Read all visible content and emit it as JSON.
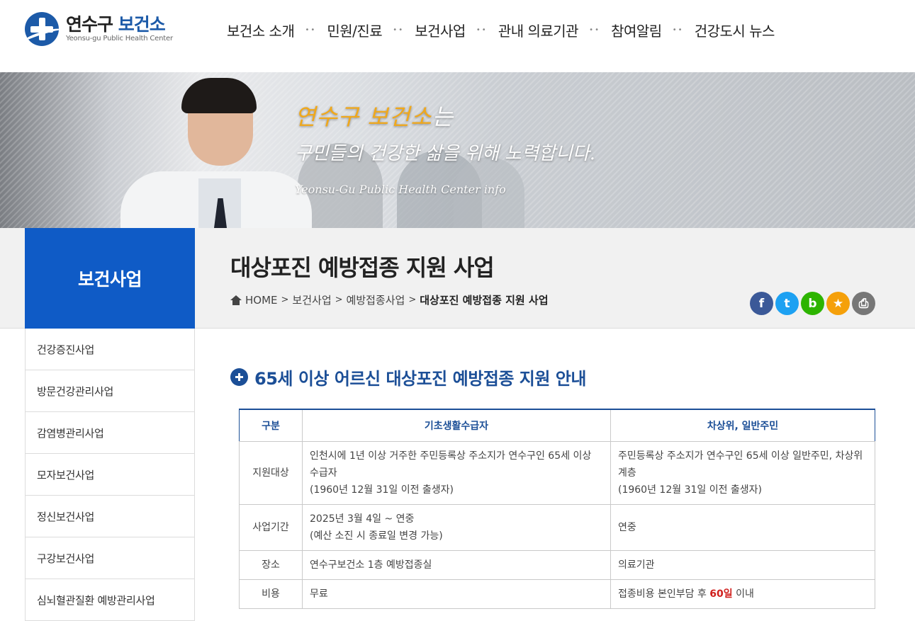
{
  "header": {
    "logo_title_a": "연수구",
    "logo_title_b": "보건소",
    "logo_sub": "Yeonsu-gu Public Health Center",
    "nav": [
      "보건소 소개",
      "민원/진료",
      "보건사업",
      "관내 의료기관",
      "참여알림",
      "건강도시 뉴스"
    ],
    "nav_sep": "••"
  },
  "banner": {
    "line1_gold": "연수구 보건소",
    "line1_rest": "는",
    "line2": "구민들의 건강한 삶을 위해 노력합니다.",
    "line3": "Yeonsu-Gu Public Health Center info"
  },
  "side": {
    "title": "보건사업",
    "menu": [
      "건강증진사업",
      "방문건강관리사업",
      "감염병관리사업",
      "모자보건사업",
      "정신보건사업",
      "구강보건사업",
      "심뇌혈관질환 예방관리사업"
    ]
  },
  "page": {
    "title": "대상포진 예방접종 지원 사업",
    "breadcrumb": [
      "HOME",
      "보건사업",
      "예방접종사업",
      "대상포진 예방접종 지원 사업"
    ],
    "bc_sep": ">",
    "share": [
      {
        "icon": "facebook-icon",
        "glyph": "f",
        "color": "#3b5998"
      },
      {
        "icon": "twitter-icon",
        "glyph": "t",
        "color": "#1da1f2"
      },
      {
        "icon": "blog-icon",
        "glyph": "b",
        "color": "#2db400"
      },
      {
        "icon": "bookmark-star-icon",
        "glyph": "★",
        "color": "#f5a00a"
      },
      {
        "icon": "print-icon",
        "glyph": "⎙",
        "color": "#777777"
      }
    ]
  },
  "content": {
    "section_title": "65세 이상 어르신 대상포진 예방접종 지원 안내",
    "table": {
      "headers": [
        "구분",
        "기초생활수급자",
        "차상위, 일반주민"
      ],
      "rows": [
        {
          "label": "지원대상",
          "a1": "인천시에 1년 이상 거주한 주민등록상 주소지가 연수구인 65세 이상 수급자",
          "a2": "(1960년 12월 31일 이전 출생자)",
          "b1": "주민등록상 주소지가 연수구인 65세 이상 일반주민, 차상위 계층",
          "b2": "(1960년 12월 31일 이전 출생자)"
        },
        {
          "label": "사업기간",
          "a1": "2025년 3월 4일 ~ 연중",
          "a2": "(예산 소진 시 종료일 변경 가능)",
          "b1": "연중",
          "b2": ""
        },
        {
          "label": "장소",
          "a1": "연수구보건소 1층 예방접종실",
          "a2": "",
          "b1": "의료기관",
          "b2": ""
        },
        {
          "label": "비용",
          "a1": "무료",
          "a2": "",
          "b1_pre": "접종비용 본인부담 후 ",
          "b1_red": "60일",
          "b1_post": " 이내"
        }
      ]
    }
  }
}
